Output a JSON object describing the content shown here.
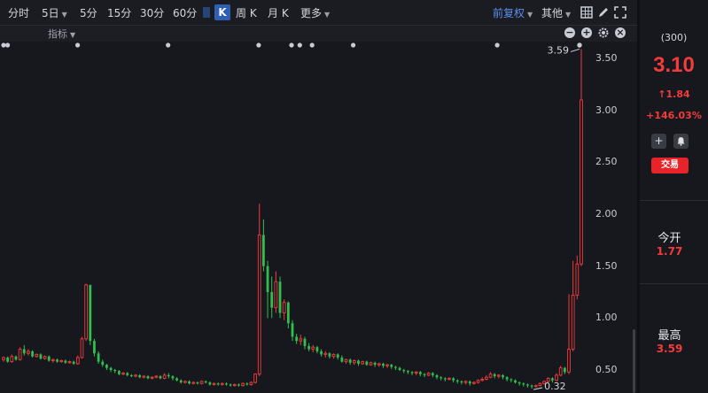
{
  "toolbar": {
    "periods": [
      "分时",
      "5日",
      "5分",
      "15分",
      "30分",
      "60分"
    ],
    "active": "K",
    "week_k": "周 K",
    "month_k": "月 K",
    "more": "更多",
    "adjust": "前复权",
    "other": "其他"
  },
  "subbar": {
    "indicator": "指标"
  },
  "sidebar": {
    "code": "(300)",
    "price": "3.10",
    "change": "1.84",
    "change_pct": "+146.03%",
    "trade_label": "交易",
    "open_label": "今开",
    "open_value": "1.77",
    "high_label": "最高",
    "high_value": "3.59"
  },
  "colors": {
    "up": "#f23b3b",
    "down": "#2fbf4f",
    "accent": "#2f5fb3",
    "bg": "#17181d"
  },
  "chart_data": {
    "type": "candlestick",
    "ylim": [
      0.3,
      3.65
    ],
    "yticks": [
      "3.50",
      "3.00",
      "2.50",
      "2.00",
      "1.50",
      "1.00",
      "0.50"
    ],
    "annotations": {
      "max_label": "3.59",
      "min_label": "0.32"
    },
    "event_markers": 14,
    "candles": [
      [
        0.6,
        0.62,
        0.63,
        0.58
      ],
      [
        0.62,
        0.58,
        0.63,
        0.57
      ],
      [
        0.58,
        0.63,
        0.65,
        0.57
      ],
      [
        0.63,
        0.6,
        0.64,
        0.59
      ],
      [
        0.6,
        0.7,
        0.72,
        0.59
      ],
      [
        0.7,
        0.66,
        0.74,
        0.64
      ],
      [
        0.66,
        0.68,
        0.7,
        0.64
      ],
      [
        0.68,
        0.63,
        0.69,
        0.62
      ],
      [
        0.63,
        0.65,
        0.66,
        0.62
      ],
      [
        0.65,
        0.61,
        0.66,
        0.6
      ],
      [
        0.61,
        0.63,
        0.64,
        0.6
      ],
      [
        0.63,
        0.59,
        0.64,
        0.58
      ],
      [
        0.59,
        0.6,
        0.61,
        0.57
      ],
      [
        0.6,
        0.58,
        0.61,
        0.57
      ],
      [
        0.58,
        0.59,
        0.6,
        0.57
      ],
      [
        0.59,
        0.57,
        0.6,
        0.56
      ],
      [
        0.57,
        0.58,
        0.59,
        0.56
      ],
      [
        0.58,
        0.56,
        0.59,
        0.55
      ],
      [
        0.56,
        0.62,
        0.64,
        0.55
      ],
      [
        0.62,
        0.8,
        0.82,
        0.61
      ],
      [
        0.8,
        1.32,
        1.33,
        0.78
      ],
      [
        1.32,
        0.78,
        1.1,
        0.74
      ],
      [
        0.78,
        0.66,
        0.8,
        0.63
      ],
      [
        0.66,
        0.58,
        0.68,
        0.56
      ],
      [
        0.58,
        0.55,
        0.6,
        0.53
      ],
      [
        0.55,
        0.52,
        0.56,
        0.5
      ],
      [
        0.52,
        0.5,
        0.53,
        0.48
      ],
      [
        0.5,
        0.49,
        0.51,
        0.47
      ],
      [
        0.49,
        0.46,
        0.5,
        0.45
      ],
      [
        0.46,
        0.47,
        0.48,
        0.45
      ],
      [
        0.47,
        0.45,
        0.48,
        0.44
      ],
      [
        0.45,
        0.44,
        0.46,
        0.43
      ],
      [
        0.44,
        0.45,
        0.46,
        0.43
      ],
      [
        0.45,
        0.43,
        0.46,
        0.42
      ],
      [
        0.43,
        0.44,
        0.45,
        0.42
      ],
      [
        0.44,
        0.42,
        0.45,
        0.41
      ],
      [
        0.42,
        0.43,
        0.44,
        0.41
      ],
      [
        0.43,
        0.44,
        0.45,
        0.42
      ],
      [
        0.44,
        0.42,
        0.45,
        0.41
      ],
      [
        0.42,
        0.45,
        0.47,
        0.41
      ],
      [
        0.45,
        0.44,
        0.47,
        0.42
      ],
      [
        0.44,
        0.42,
        0.45,
        0.4
      ],
      [
        0.42,
        0.4,
        0.43,
        0.39
      ],
      [
        0.4,
        0.38,
        0.41,
        0.37
      ],
      [
        0.38,
        0.39,
        0.4,
        0.37
      ],
      [
        0.39,
        0.37,
        0.4,
        0.36
      ],
      [
        0.37,
        0.38,
        0.39,
        0.36
      ],
      [
        0.38,
        0.37,
        0.39,
        0.36
      ],
      [
        0.37,
        0.39,
        0.4,
        0.36
      ],
      [
        0.39,
        0.38,
        0.4,
        0.37
      ],
      [
        0.38,
        0.36,
        0.39,
        0.35
      ],
      [
        0.36,
        0.37,
        0.38,
        0.35
      ],
      [
        0.37,
        0.36,
        0.38,
        0.35
      ],
      [
        0.36,
        0.37,
        0.38,
        0.35
      ],
      [
        0.37,
        0.36,
        0.38,
        0.35
      ],
      [
        0.36,
        0.35,
        0.37,
        0.34
      ],
      [
        0.35,
        0.36,
        0.37,
        0.34
      ],
      [
        0.36,
        0.35,
        0.37,
        0.34
      ],
      [
        0.35,
        0.37,
        0.38,
        0.34
      ],
      [
        0.37,
        0.36,
        0.38,
        0.35
      ],
      [
        0.36,
        0.38,
        0.39,
        0.35
      ],
      [
        0.38,
        0.46,
        0.47,
        0.37
      ],
      [
        0.46,
        1.8,
        2.1,
        0.44
      ],
      [
        1.8,
        1.5,
        1.95,
        1.45
      ],
      [
        1.5,
        1.25,
        1.55,
        1.0
      ],
      [
        1.25,
        1.1,
        1.4,
        1.0
      ],
      [
        1.1,
        1.35,
        1.45,
        1.05
      ],
      [
        1.35,
        1.05,
        1.4,
        1.0
      ],
      [
        1.05,
        1.15,
        1.18,
        0.98
      ],
      [
        1.15,
        0.95,
        1.16,
        0.9
      ],
      [
        0.95,
        0.82,
        0.98,
        0.78
      ],
      [
        0.82,
        0.78,
        0.85,
        0.75
      ],
      [
        0.78,
        0.8,
        0.84,
        0.74
      ],
      [
        0.8,
        0.73,
        0.82,
        0.7
      ],
      [
        0.73,
        0.7,
        0.76,
        0.68
      ],
      [
        0.7,
        0.72,
        0.74,
        0.67
      ],
      [
        0.72,
        0.68,
        0.73,
        0.66
      ],
      [
        0.68,
        0.65,
        0.7,
        0.63
      ],
      [
        0.65,
        0.66,
        0.68,
        0.62
      ],
      [
        0.66,
        0.63,
        0.67,
        0.61
      ],
      [
        0.63,
        0.65,
        0.66,
        0.61
      ],
      [
        0.65,
        0.62,
        0.66,
        0.6
      ],
      [
        0.62,
        0.58,
        0.64,
        0.57
      ],
      [
        0.58,
        0.6,
        0.61,
        0.56
      ],
      [
        0.6,
        0.57,
        0.61,
        0.55
      ],
      [
        0.57,
        0.59,
        0.6,
        0.55
      ],
      [
        0.59,
        0.56,
        0.6,
        0.54
      ],
      [
        0.56,
        0.58,
        0.59,
        0.55
      ],
      [
        0.58,
        0.55,
        0.59,
        0.54
      ],
      [
        0.55,
        0.57,
        0.58,
        0.54
      ],
      [
        0.57,
        0.55,
        0.58,
        0.53
      ],
      [
        0.55,
        0.56,
        0.57,
        0.53
      ],
      [
        0.56,
        0.54,
        0.57,
        0.52
      ],
      [
        0.54,
        0.55,
        0.56,
        0.52
      ],
      [
        0.55,
        0.53,
        0.56,
        0.51
      ],
      [
        0.53,
        0.52,
        0.54,
        0.5
      ],
      [
        0.52,
        0.5,
        0.53,
        0.49
      ],
      [
        0.5,
        0.49,
        0.51,
        0.47
      ],
      [
        0.49,
        0.48,
        0.5,
        0.46
      ],
      [
        0.48,
        0.47,
        0.49,
        0.45
      ],
      [
        0.47,
        0.48,
        0.49,
        0.45
      ],
      [
        0.48,
        0.46,
        0.49,
        0.44
      ],
      [
        0.46,
        0.45,
        0.47,
        0.43
      ],
      [
        0.45,
        0.47,
        0.48,
        0.44
      ],
      [
        0.47,
        0.45,
        0.48,
        0.43
      ],
      [
        0.45,
        0.43,
        0.46,
        0.41
      ],
      [
        0.43,
        0.42,
        0.44,
        0.4
      ],
      [
        0.42,
        0.41,
        0.43,
        0.39
      ],
      [
        0.41,
        0.42,
        0.43,
        0.4
      ],
      [
        0.42,
        0.4,
        0.43,
        0.38
      ],
      [
        0.4,
        0.39,
        0.41,
        0.37
      ],
      [
        0.39,
        0.38,
        0.4,
        0.36
      ],
      [
        0.38,
        0.39,
        0.4,
        0.36
      ],
      [
        0.39,
        0.37,
        0.4,
        0.35
      ],
      [
        0.37,
        0.38,
        0.39,
        0.36
      ],
      [
        0.38,
        0.4,
        0.41,
        0.37
      ],
      [
        0.4,
        0.41,
        0.43,
        0.39
      ],
      [
        0.41,
        0.43,
        0.45,
        0.4
      ],
      [
        0.43,
        0.46,
        0.48,
        0.42
      ],
      [
        0.46,
        0.44,
        0.47,
        0.42
      ],
      [
        0.44,
        0.45,
        0.46,
        0.42
      ],
      [
        0.45,
        0.43,
        0.46,
        0.41
      ],
      [
        0.43,
        0.41,
        0.44,
        0.39
      ],
      [
        0.41,
        0.4,
        0.42,
        0.38
      ],
      [
        0.4,
        0.38,
        0.41,
        0.37
      ],
      [
        0.38,
        0.37,
        0.39,
        0.35
      ],
      [
        0.37,
        0.36,
        0.38,
        0.34
      ],
      [
        0.36,
        0.35,
        0.37,
        0.33
      ],
      [
        0.35,
        0.34,
        0.36,
        0.32
      ],
      [
        0.34,
        0.35,
        0.36,
        0.33
      ],
      [
        0.35,
        0.37,
        0.38,
        0.34
      ],
      [
        0.37,
        0.39,
        0.4,
        0.36
      ],
      [
        0.39,
        0.42,
        0.43,
        0.38
      ],
      [
        0.42,
        0.4,
        0.43,
        0.38
      ],
      [
        0.4,
        0.45,
        0.47,
        0.39
      ],
      [
        0.45,
        0.52,
        0.54,
        0.44
      ],
      [
        0.52,
        0.48,
        0.53,
        0.46
      ],
      [
        0.48,
        0.7,
        1.23,
        0.46
      ],
      [
        0.7,
        1.22,
        1.55,
        0.68
      ],
      [
        1.22,
        1.52,
        1.6,
        1.18
      ],
      [
        1.52,
        3.1,
        3.59,
        1.5
      ]
    ]
  }
}
